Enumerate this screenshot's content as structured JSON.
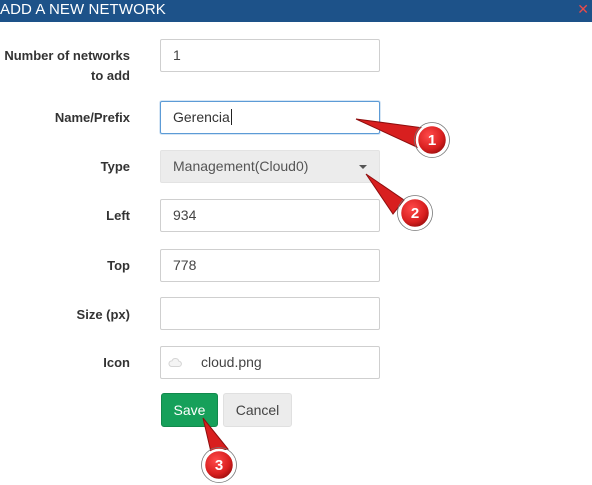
{
  "dialog": {
    "title": "ADD A NEW NETWORK",
    "close_glyph": "✕"
  },
  "form": {
    "count_label": "Number of networks to add",
    "count_value": "1",
    "name_label": "Name/Prefix",
    "name_value": "Gerencia",
    "type_label": "Type",
    "type_value": "Management(Cloud0)",
    "left_label": "Left",
    "left_value": "934",
    "top_label": "Top",
    "top_value": "778",
    "size_label": "Size (px)",
    "size_value": "",
    "icon_label": "Icon",
    "icon_value": "cloud.png",
    "icon_name": "cloud-icon"
  },
  "buttons": {
    "save": "Save",
    "cancel": "Cancel"
  },
  "annotations": [
    {
      "number": "1",
      "target": "name-prefix-input"
    },
    {
      "number": "2",
      "target": "type-select"
    },
    {
      "number": "3",
      "target": "save-button"
    }
  ],
  "colors": {
    "titlebar": "#1d5289",
    "save_button": "#16a05a",
    "annotation_marker": "#d81f1f"
  }
}
